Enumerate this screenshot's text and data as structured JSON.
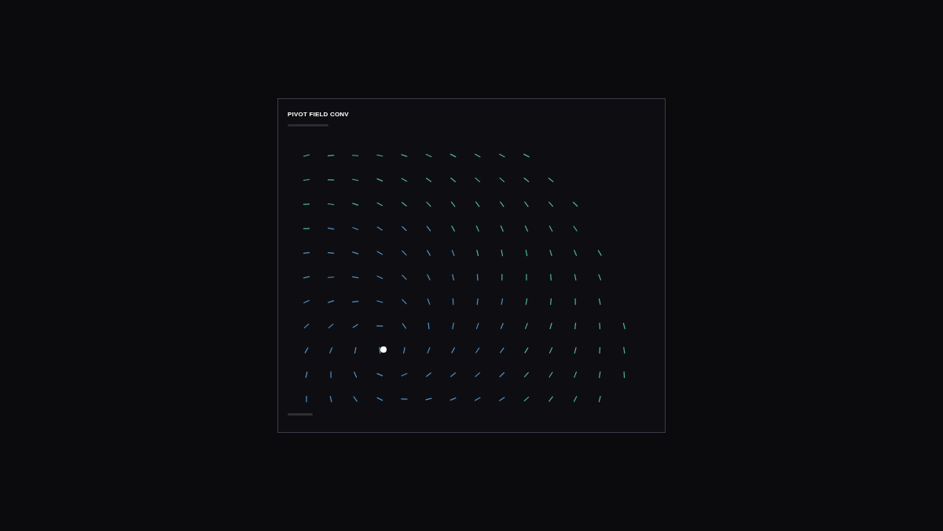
{
  "card": {
    "title": "PIVOT FIELD CONV"
  }
}
